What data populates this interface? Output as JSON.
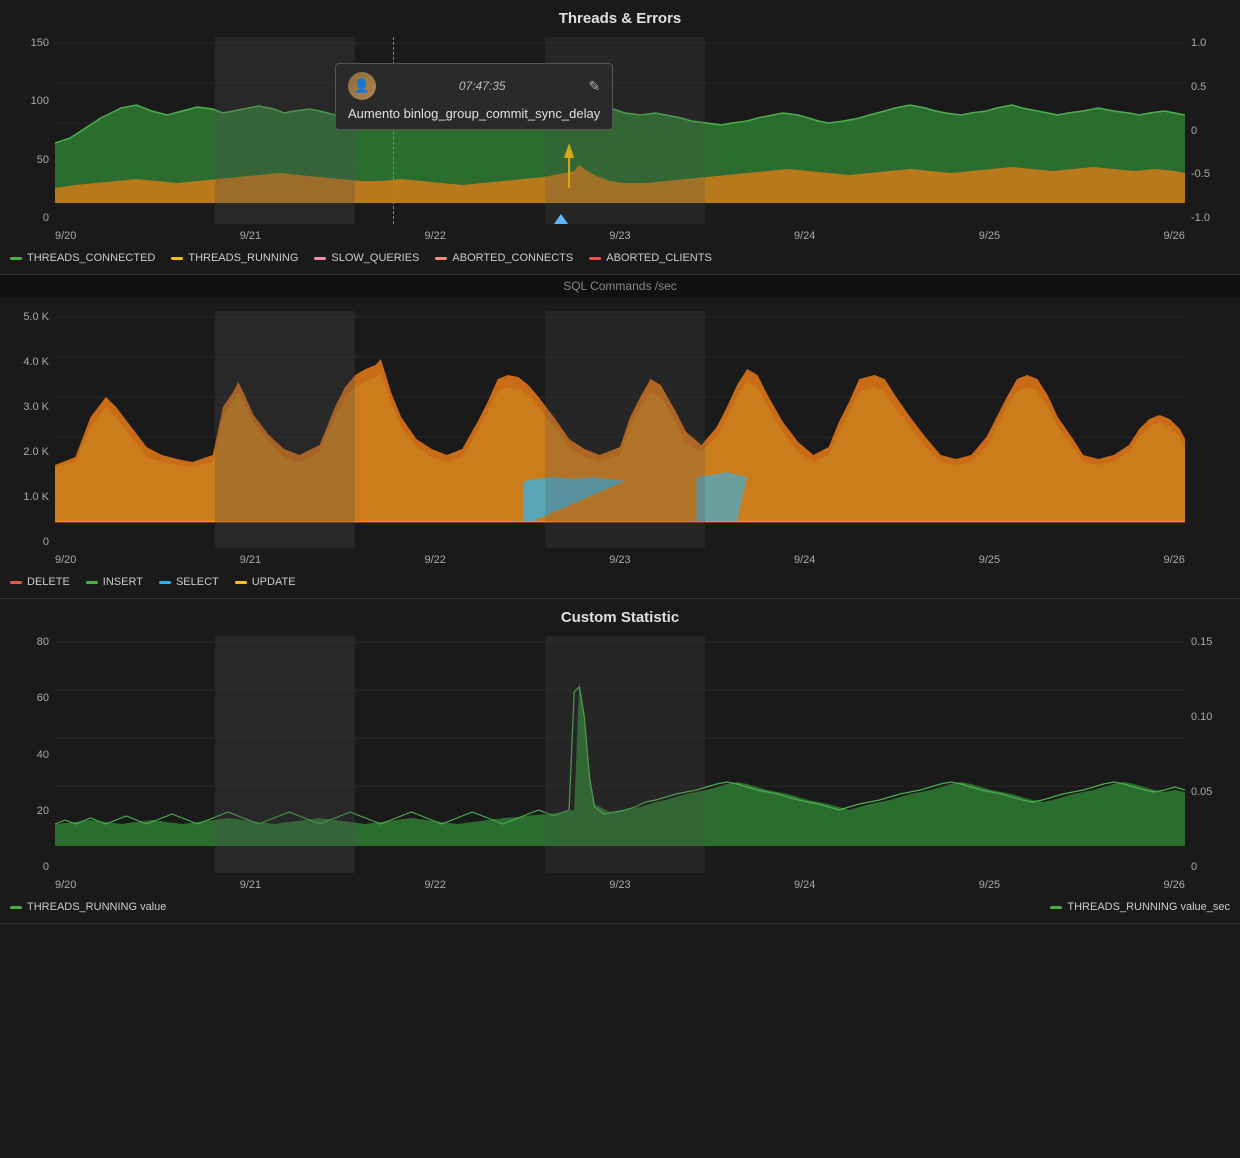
{
  "charts": {
    "threads_errors": {
      "title": "Threads & Errors",
      "y_left_labels": [
        "150",
        "100",
        "50",
        "0"
      ],
      "y_right_labels": [
        "1.0",
        "0.5",
        "0",
        "-0.5",
        "-1.0"
      ],
      "x_labels": [
        "9/20",
        "9/21",
        "9/22",
        "9/23",
        "9/24",
        "9/25",
        "9/26"
      ],
      "legend_items": [
        {
          "label": "THREADS_CONNECTED",
          "color": "#4caf50"
        },
        {
          "label": "THREADS_RUNNING",
          "color": "#ffc107"
        },
        {
          "label": "SLOW_QUERIES",
          "color": "#f48fb1"
        },
        {
          "label": "ABORTED_CONNECTS",
          "color": "#ff8a80"
        },
        {
          "label": "ABORTED_CLIENTS",
          "color": "#ef5350"
        }
      ]
    },
    "sql_commands": {
      "title": "SQL Commands /sec",
      "y_left_labels": [
        "5.0 K",
        "4.0 K",
        "3.0 K",
        "2.0 K",
        "1.0 K",
        "0"
      ],
      "x_labels": [
        "9/20",
        "9/21",
        "9/22",
        "9/23",
        "9/24",
        "9/25",
        "9/26"
      ],
      "legend_items": [
        {
          "label": "DELETE",
          "color": "#ef5350"
        },
        {
          "label": "INSERT",
          "color": "#4caf50"
        },
        {
          "label": "SELECT",
          "color": "#29b6f6"
        },
        {
          "label": "UPDATE",
          "color": "#ffc107"
        }
      ]
    },
    "custom_statistic": {
      "title": "Custom Statistic",
      "y_left_labels": [
        "80",
        "60",
        "40",
        "20",
        "0"
      ],
      "y_right_labels": [
        "0.15",
        "0.10",
        "0.05",
        "0"
      ],
      "x_labels": [
        "9/20",
        "9/21",
        "9/22",
        "9/23",
        "9/24",
        "9/25",
        "9/26"
      ],
      "legend_items_left": [
        {
          "label": "THREADS_RUNNING value",
          "color": "#4caf50"
        }
      ],
      "legend_items_right": [
        {
          "label": "THREADS_RUNNING value_sec",
          "color": "#4caf50"
        }
      ]
    }
  },
  "tooltip": {
    "time": "07:47:35",
    "edit_icon": "✎",
    "text": "Aumento binlog_group_commit_sync_delay"
  }
}
